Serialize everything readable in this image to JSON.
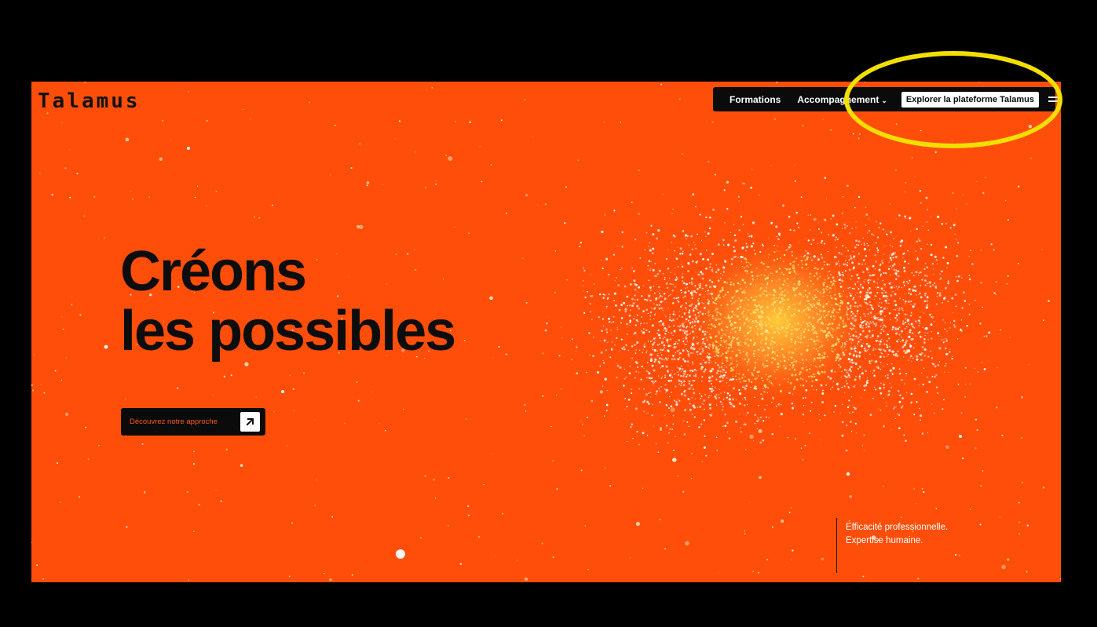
{
  "brand": {
    "logo": "Talamus"
  },
  "nav": {
    "items": [
      {
        "label": "Formations"
      },
      {
        "label": "Accompagnement"
      }
    ],
    "cta_label": "Explorer la plateforme Talamus",
    "menu_icon": "hamburger-menu-icon"
  },
  "hero": {
    "headline_line1": "Créons",
    "headline_line2": "les possibles",
    "cta_label": "Découvrez notre approche",
    "cta_icon": "arrow-up-right-icon",
    "tagline_line1": "Efficacité professionnelle.",
    "tagline_line2": "Expertise humaine."
  },
  "colors": {
    "background": "#ff4e0a",
    "frame": "#000000",
    "nav_bg": "#0b0b0b",
    "cta_text": "#ff5a1a",
    "annotation": "#f2df00"
  }
}
